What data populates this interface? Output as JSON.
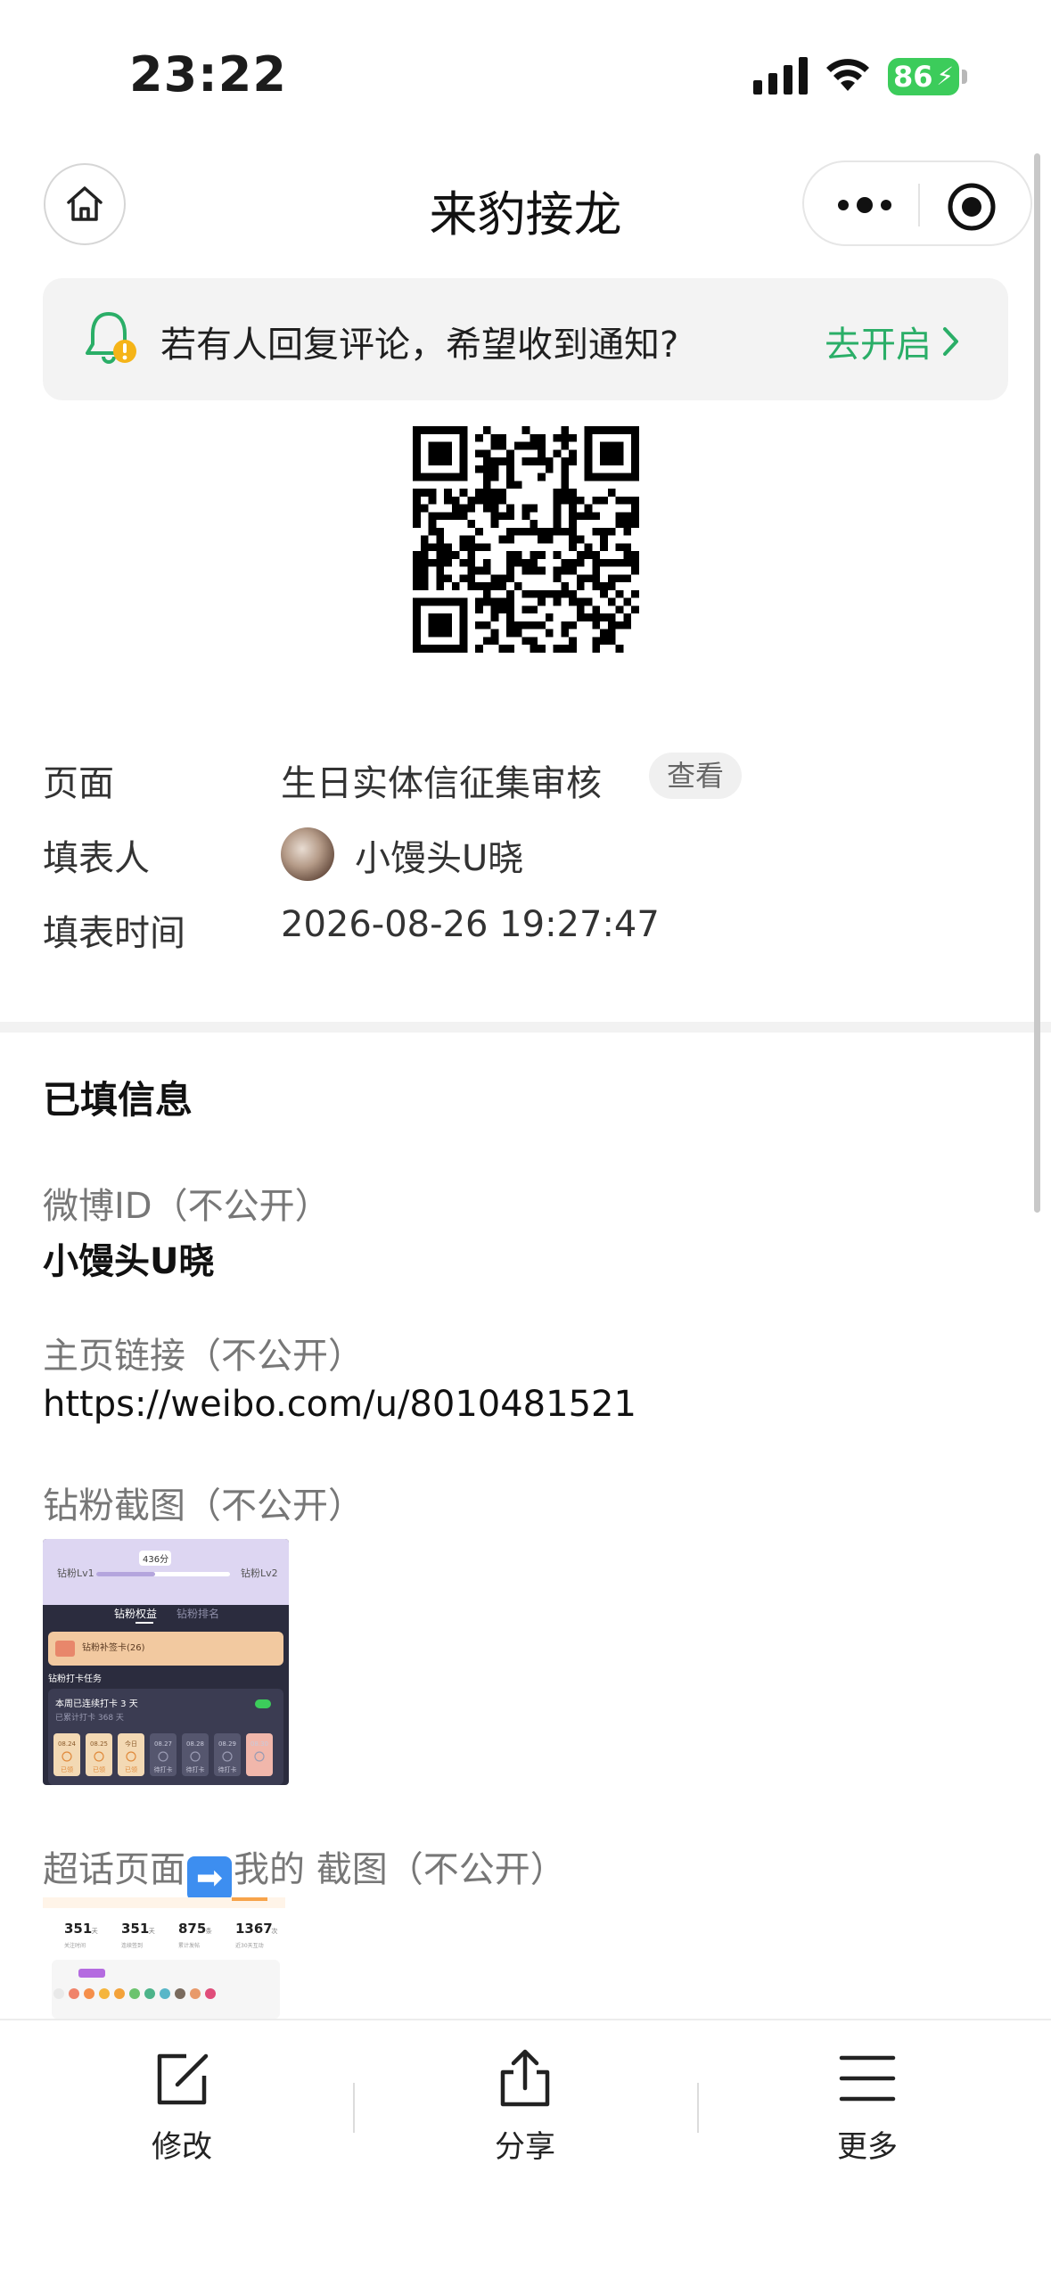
{
  "status_bar": {
    "time": "23:22",
    "battery": "86"
  },
  "nav": {
    "title": "来豹接龙"
  },
  "notify": {
    "text": "若有人回复评论，希望收到通知?",
    "action": "去开启"
  },
  "meta": {
    "page_label": "页面",
    "page_value": "生日实体信征集审核",
    "view_label": "查看",
    "filler_label": "填表人",
    "filler_name": "小馒头U晓",
    "time_label": "填表时间",
    "time_value": "2026-08-26 19:27:47"
  },
  "filled": {
    "title": "已填信息",
    "weibo_id_label": "微博ID（不公开）",
    "weibo_id_value": "小馒头U晓",
    "homepage_label": "主页链接（不公开）",
    "homepage_value": "https://weibo.com/u/8010481521",
    "fans_screenshot_label": "钻粉截图（不公开）",
    "topic_label_pre": "超话页面",
    "topic_label_post": "我的 截图（不公开）"
  },
  "thumb1": {
    "lv1": "钻粉Lv1",
    "lv2": "钻粉Lv2",
    "score": "436分",
    "tab1": "钻粉权益",
    "tab2": "钻粉排名",
    "card_title": "钻粉补签卡(26)",
    "task_title": "钻粉打卡任务",
    "streak": "本周已连续打卡 3 天",
    "total": "已累计打卡 368 天",
    "days": [
      "08.24",
      "08.25",
      "今日",
      "08.27",
      "08.28",
      "08.29",
      "08.30"
    ],
    "day_status": [
      "已领",
      "已领",
      "已领",
      "待打卡",
      "待打卡",
      "待打卡",
      ""
    ]
  },
  "thumb2": {
    "stats": [
      "351",
      "351",
      "875",
      "1367"
    ],
    "units": [
      "天",
      "天",
      "条",
      "次"
    ],
    "captions": [
      "关注时间",
      "连续签到",
      "累计发帖",
      "近30天互动"
    ]
  },
  "toolbar": {
    "edit": "修改",
    "share": "分享",
    "more": "更多"
  },
  "colors": {
    "accent_green": "#2aae67",
    "battery": "#3ccc5b"
  }
}
